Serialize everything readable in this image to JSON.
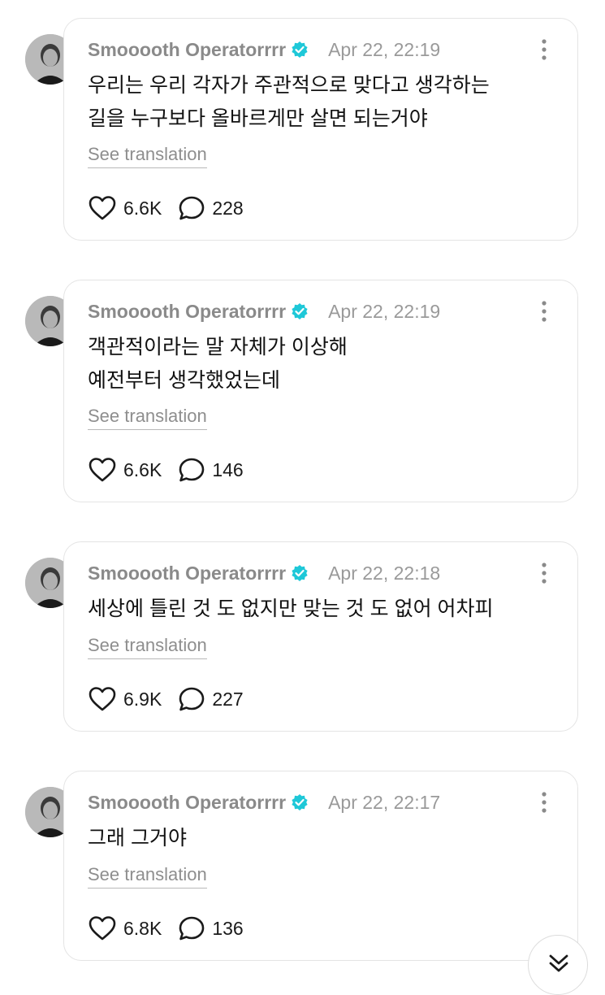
{
  "posts": [
    {
      "username": "Smooooth Operatorrrr",
      "timestamp": "Apr 22, 22:19",
      "lines": [
        "우리는 우리 각자가 주관적으로 맞다고 생각하는",
        "길을 누구보다 올바르게만 살면 되는거야"
      ],
      "translate_label": "See translation",
      "likes": "6.6K",
      "replies": "228"
    },
    {
      "username": "Smooooth Operatorrrr",
      "timestamp": "Apr 22, 22:19",
      "lines": [
        "객관적이라는 말 자체가 이상해",
        "예전부터 생각했었는데"
      ],
      "translate_label": "See translation",
      "likes": "6.6K",
      "replies": "146"
    },
    {
      "username": "Smooooth Operatorrrr",
      "timestamp": "Apr 22, 22:18",
      "lines": [
        "세상에 틀린 것 도 없지만 맞는 것 도 없어 어차피"
      ],
      "translate_label": "See translation",
      "likes": "6.9K",
      "replies": "227"
    },
    {
      "username": "Smooooth Operatorrrr",
      "timestamp": "Apr 22, 22:17",
      "lines": [
        "그래 그거야"
      ],
      "translate_label": "See translation",
      "likes": "6.8K",
      "replies": "136"
    }
  ],
  "colors": {
    "verified_badge": "#1ec8d8",
    "card_border": "#e4e4e4",
    "muted_text": "#8a8a8a"
  },
  "icons": {
    "verified": "verified-badge-icon",
    "more": "more-options-icon",
    "like": "heart-icon",
    "reply": "reply-bubble-icon",
    "scroll": "double-chevron-down-icon"
  }
}
